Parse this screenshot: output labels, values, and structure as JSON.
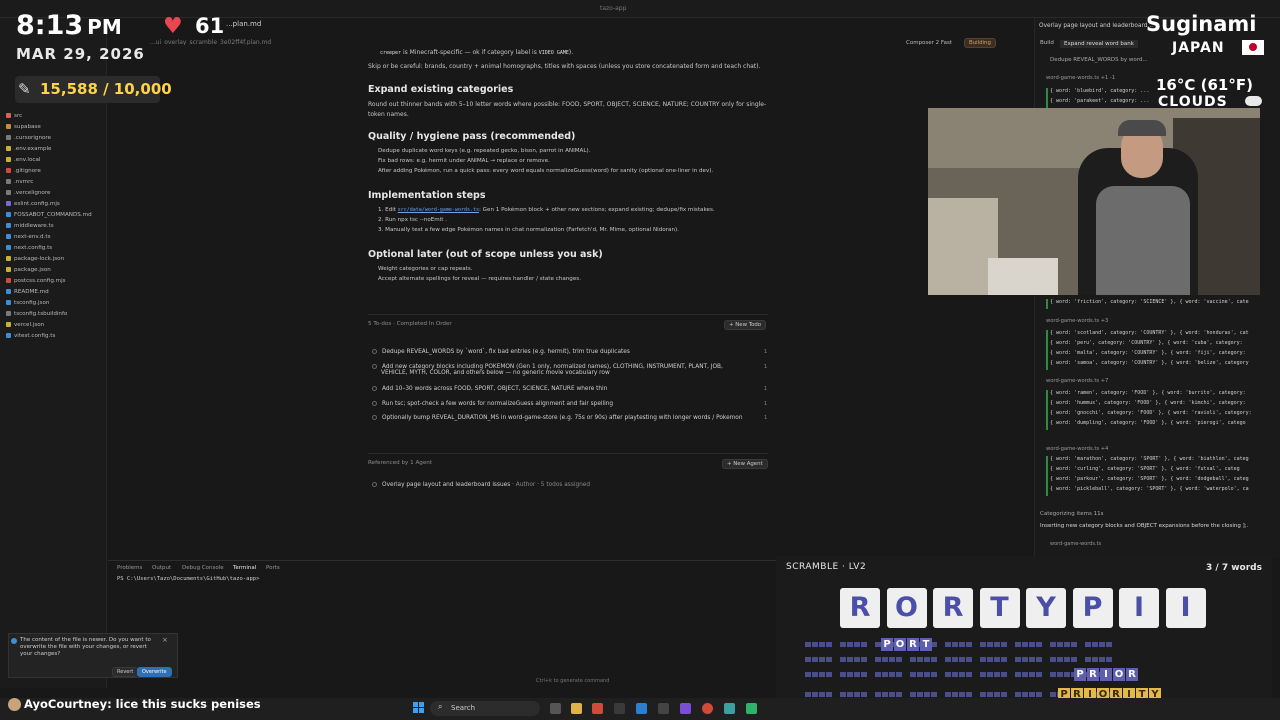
{
  "window": {
    "title": "tazo-app",
    "active_tab": "...plan.md",
    "breadcrumb": "...ui_overlay_scramble_3e02ff4f.plan.md"
  },
  "sidebar": {
    "items": [
      {
        "label": "src",
        "color": "#e25c5c"
      },
      {
        "label": "supabase",
        "color": "#c28c3a"
      },
      {
        "label": ".cursorignore",
        "color": "#7a7a7a"
      },
      {
        "label": ".env.example",
        "color": "#c9b13a"
      },
      {
        "label": ".env.local",
        "color": "#c9b13a"
      },
      {
        "label": ".gitignore",
        "color": "#d24a3a"
      },
      {
        "label": ".nvmrc",
        "color": "#7a7a7a"
      },
      {
        "label": ".vercelignore",
        "color": "#7a7a7a"
      },
      {
        "label": "eslint.config.mjs",
        "color": "#7b68d6"
      },
      {
        "label": "FOSSABOT_COMMANDS.md",
        "color": "#3a8fd6"
      },
      {
        "label": "middleware.ts",
        "color": "#3a8fd6"
      },
      {
        "label": "next-env.d.ts",
        "color": "#3a8fd6"
      },
      {
        "label": "next.config.ts",
        "color": "#3a8fd6"
      },
      {
        "label": "package-lock.json",
        "color": "#c9b13a"
      },
      {
        "label": "package.json",
        "color": "#c9b13a"
      },
      {
        "label": "postcss.config.mjs",
        "color": "#d24a3a"
      },
      {
        "label": "README.md",
        "color": "#3a8fd6"
      },
      {
        "label": "tsconfig.json",
        "color": "#3a8fd6"
      },
      {
        "label": "tsconfig.tsbuildinfo",
        "color": "#7a7a7a"
      },
      {
        "label": "vercel.json",
        "color": "#c9b13a"
      },
      {
        "label": "vitest.config.ts",
        "color": "#3a8fd6"
      }
    ]
  },
  "doc": {
    "line1a": "creeper",
    "line1b": " is Minecraft-specific — ok if category label is ",
    "line1c": "VIDEO GAME",
    "line1d": ").",
    "line2": "Skip or be careful: brands, country + animal homographs, titles with spaces (unless you store concatenated form and teach chat).",
    "h_expand": "Expand existing categories",
    "expand_text": "Round out thinner bands with 5–10 letter words where possible: FOOD, SPORT, OBJECT, SCIENCE, NATURE; COUNTRY only for single-",
    "expand_text2": "token names.",
    "h_quality": "Quality / hygiene pass (recommended)",
    "q1": "Dedupe duplicate word keys (e.g. repeated gecko, bison, parrot in ANIMAL).",
    "q2": "Fix bad rows: e.g. hermit under ANIMAL → replace or remove.",
    "q3": "After adding Pokémon, run a quick pass: every word equals normalizeGuess(word) for sanity (optional one-liner in dev).",
    "h_impl": "Implementation steps",
    "i1a": "1. Edit ",
    "i1b": "src/data/word-game-words.ts",
    "i1c": ": Gen 1 Pokémon block + other new sections; expand existing; dedupe/fix mistakes.",
    "i2": "2. Run npx tsc --noEmit .",
    "i3": "3. Manually test a few edge Pokémon names in chat normalization (Farfetch'd, Mr. Mime, optional Nidoran).",
    "h_optional": "Optional later (out of scope unless you ask)",
    "o1": "Weight categories or cap repeats.",
    "o2": "Accept alternate spellings for reveal — requires handler / state changes."
  },
  "todos": {
    "header": "5 To-dos · Completed In Order",
    "new_button": "+ New Todo",
    "items": [
      {
        "text": "Dedupe REVEAL_WORDS by `word`, fix bad entries (e.g. hermit), trim true duplicates",
        "count": "1"
      },
      {
        "text": "Add new category blocks including POKEMON (Gen 1 only, normalized names), CLOTHING, INSTRUMENT, PLANT, JOB,",
        "text2": "VEHICLE, MYTH, COLOR, and others below — no generic movie vocabulary row",
        "count": "1"
      },
      {
        "text": "Add 10–30 words across FOOD, SPORT, OBJECT, SCIENCE, NATURE where thin",
        "count": "1"
      },
      {
        "text": "Run tsc; spot-check a few words for normalizeGuess alignment and fair spelling",
        "count": "1"
      },
      {
        "text": "Optionally bump REVEAL_DURATION_MS in word-game-store (e.g. 75s or 90s) after playtesting with longer words / Pokemon",
        "count": "1"
      }
    ],
    "ref_header": "Referenced by 1 Agent",
    "new_agent": "+ New Agent",
    "agent_item": "Overlay page layout and leaderboard issues",
    "agent_meta": " · Author · 5 todos assigned"
  },
  "panel": {
    "tabs": [
      "Problems",
      "Output",
      "Debug Console",
      "Terminal",
      "Ports"
    ],
    "prompt": "PS C:\\Users\\Tazo\\Documents\\GitHub\\tazo-app>",
    "hint": "Ctrl+k to generate command"
  },
  "right": {
    "title": "Overlay page layout and leaderboard...",
    "composer": "Composer 2 Fast",
    "status": "Building",
    "build": "Build",
    "expand": "Expand reveal word bank",
    "dedupe": "Dedupe REVEAL_WORDS by word...",
    "file": "word-game-words.ts",
    "blocks": [
      {
        "file": "word-game-words.ts  +1 -1",
        "lines": [
          "{ word: 'bluebird', category: ...",
          "{ word: 'parakeet', category: ..."
        ]
      },
      {
        "file": "",
        "lines": [
          "{ word: 'friction', category: 'SCIENCE' }, { word: 'vaccine', cate"
        ]
      },
      {
        "file": "word-game-words.ts  +3",
        "lines": [
          "{ word: 'scotland', category: 'COUNTRY' }, { word: 'honduras', cat",
          "{ word: 'peru', category: 'COUNTRY' }, { word: 'cuba', category:",
          "{ word: 'malta', category: 'COUNTRY' }, { word: 'fiji', category:",
          "{ word: 'samoa', category: 'COUNTRY' }, { word: 'belize', category"
        ]
      },
      {
        "file": "word-game-words.ts  +7",
        "lines": [
          "{ word: 'ramen', category: 'FOOD' }, { word: 'burrito', category:",
          "{ word: 'hummus', category: 'FOOD' }, { word: 'kimchi', category:",
          "{ word: 'gnocchi', category: 'FOOD' }, { word: 'ravioli', category:",
          "{ word: 'dumpling', category: 'FOOD' }, { word: 'pierogi', catego"
        ]
      },
      {
        "file": "word-game-words.ts  +4",
        "lines": [
          "{ word: 'marathon', category: 'SPORT' }, { word: 'biathlon', categ",
          "{ word: 'curling', category: 'SPORT' }, { word: 'futsal', categ",
          "{ word: 'parkour', category: 'SPORT' }, { word: 'dodgeball', categ",
          "{ word: 'pickleball', category: 'SPORT' }, { word: 'waterpolo', ca"
        ]
      }
    ],
    "categorizing": "Categorizing items 11s",
    "inserting": "Inserting new category blocks and OBJECT expansions before the closing ];."
  },
  "overlay": {
    "time": "8:13",
    "ampm": "PM",
    "date": "MAR 29, 2026",
    "hearts": "61",
    "subs": "15,588 / 10,000",
    "city": "Suginami",
    "country": "JAPAN",
    "temp": "16°C (61°F)",
    "condition": "CLOUDS"
  },
  "game": {
    "title": "SCRAMBLE · LV2",
    "count": "3 / 7 words",
    "letters": [
      "R",
      "O",
      "R",
      "T",
      "Y",
      "P",
      "I",
      "I"
    ],
    "found": [
      "PORT",
      "PRIOR",
      "PRIORITY"
    ]
  },
  "notification": {
    "text": "The content of the file is newer. Do you want to overwrite the file with your changes, or revert your changes?",
    "revert": "Revert",
    "overwrite": "Overwrite"
  },
  "chat": {
    "user": "AyoCourtney",
    "message": ": lice this sucks penises"
  },
  "taskbar": {
    "search": "Search"
  },
  "colors": {
    "accent": "#3a8fd6",
    "game_purple": "#5f5fb0",
    "game_gold": "#e3b94a",
    "heart": "#e8474f"
  }
}
